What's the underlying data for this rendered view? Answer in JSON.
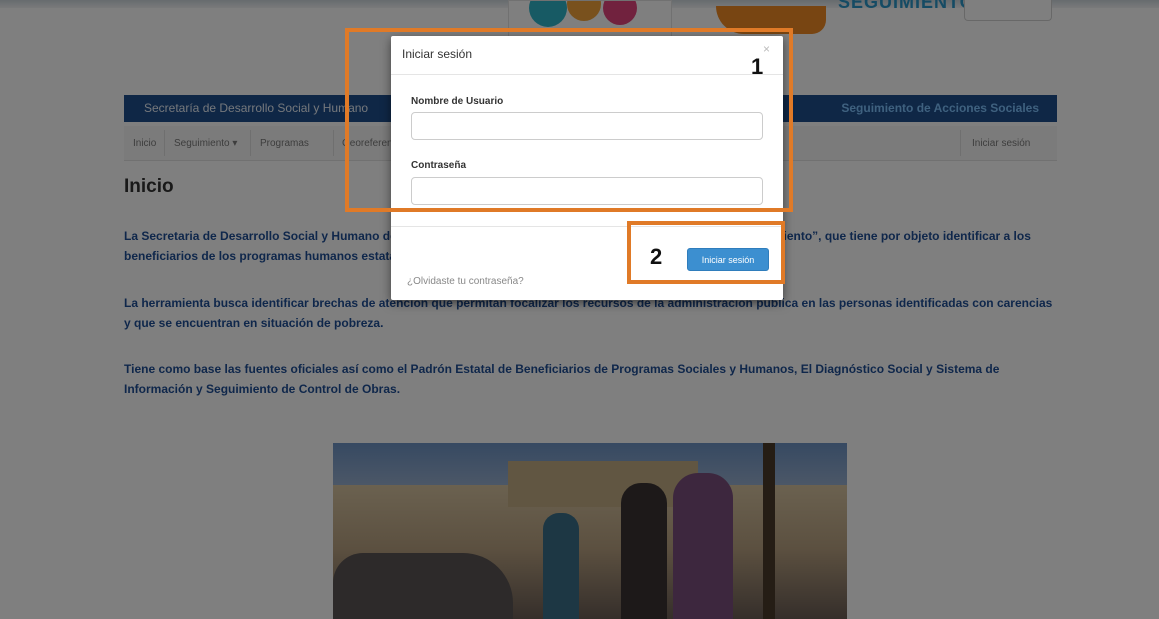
{
  "header": {
    "logo_right_text": "SEGUIMIENTO"
  },
  "navbar": {
    "brand": "Secretaría de Desarrollo Social y Humano",
    "right_title": "Seguimiento de Acciones Sociales"
  },
  "subnav": {
    "items": [
      "Inicio",
      "Seguimiento",
      "Programas",
      "Georeferenciación"
    ],
    "login": "Iniciar sesión"
  },
  "main": {
    "title": "Inicio",
    "paragraphs": [
      "La Secretaria de Desarrollo Social y Humano del Estado de Guanajuato ha creado un sistema denominado “Seguimiento”, que tiene por objeto identificar a los beneficiarios de los programas humanos estatales y federales.",
      "La herramienta busca identificar brechas de atención que permitan focalizar los recursos de la administración pública en las personas identificadas con carencias y que se encuentran en situación de pobreza.",
      "Tiene como base las fuentes oficiales así como el Padrón Estatal de Beneficiarios de Programas Sociales y Humanos, El Diagnóstico Social y Sistema de Información y Seguimiento de Control de Obras."
    ]
  },
  "modal": {
    "title": "Iniciar sesión",
    "close": "×",
    "username_label": "Nombre de Usuario",
    "username_value": "",
    "password_label": "Contraseña",
    "password_value": "",
    "forgot_link": "¿Olvidaste tu contraseña?",
    "submit": "Iniciar sesión"
  },
  "callouts": {
    "one": "1",
    "two": "2"
  },
  "colors": {
    "navbar": "#1e4f8c",
    "callout": "#e07a27",
    "button": "#3c8fd0",
    "paragraph_text": "#1f4e96"
  }
}
